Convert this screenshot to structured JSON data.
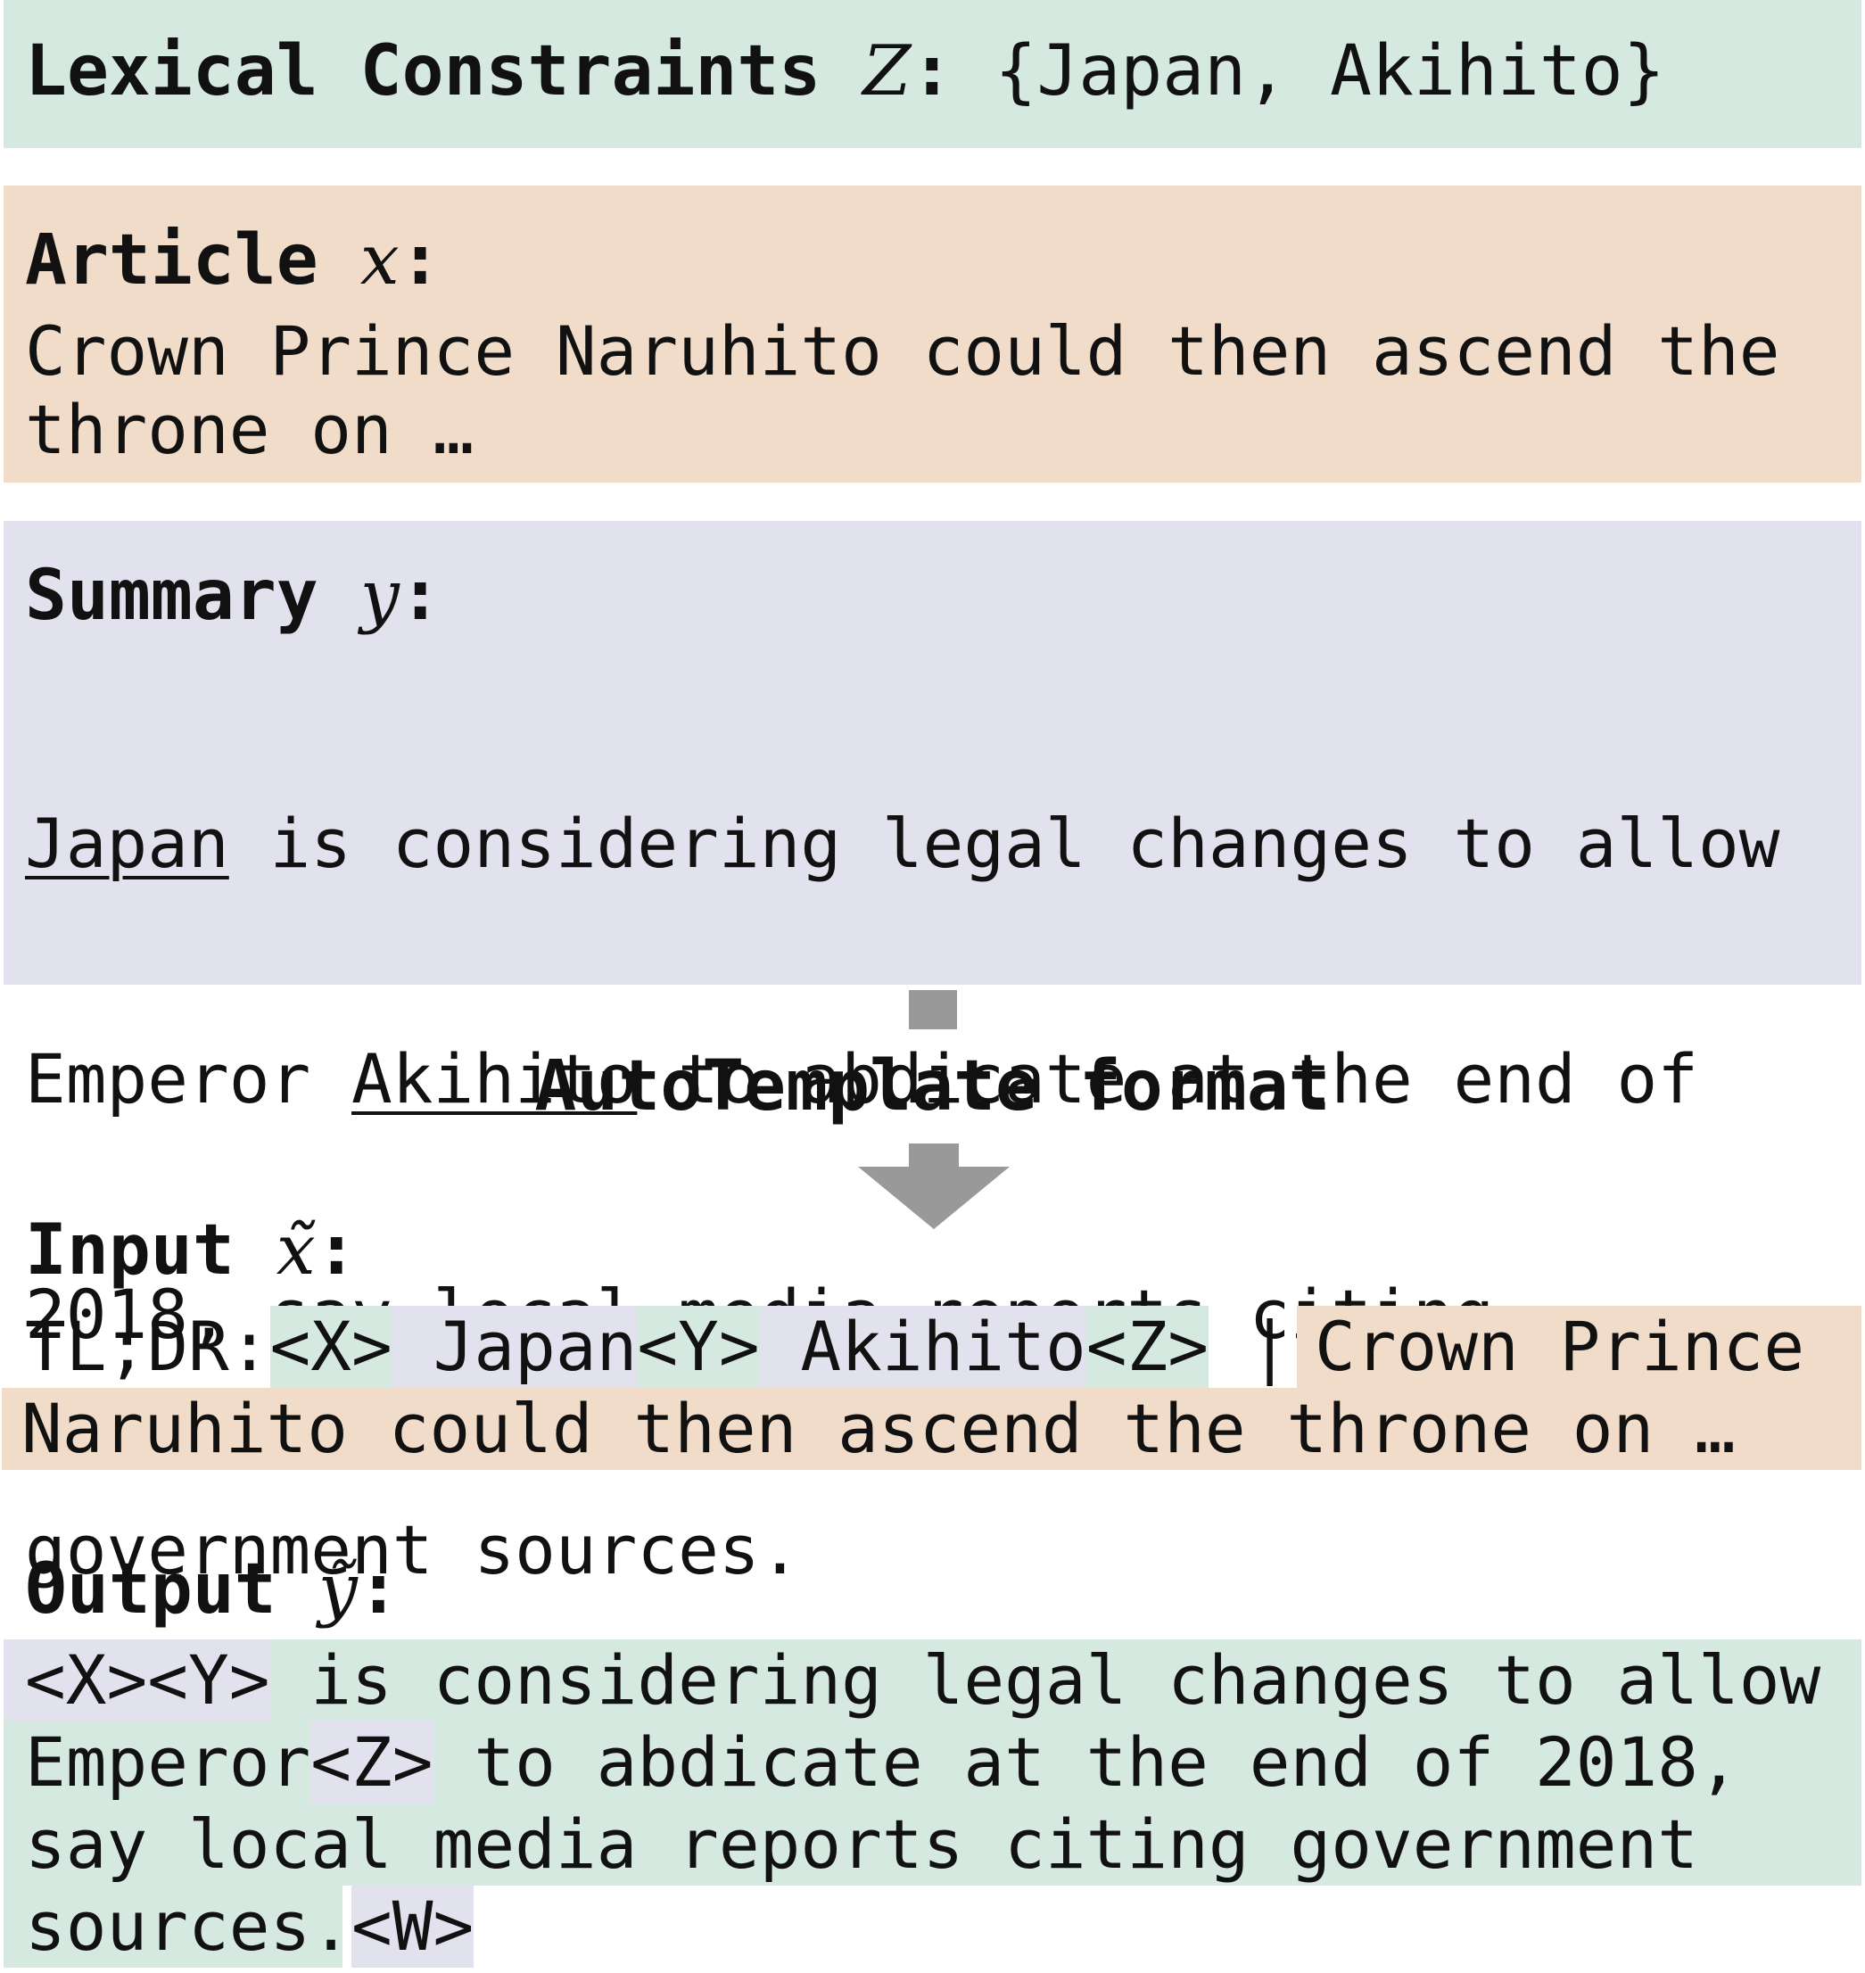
{
  "constraints": {
    "label": "Lexical Constraints",
    "symbol": "Z",
    "colon": ":",
    "value": "{Japan, Akihito}"
  },
  "article": {
    "label": "Article",
    "symbol": "x",
    "colon": ":",
    "lines": [
      "Crown Prince Naruhito could then ascend the",
      "throne on …"
    ]
  },
  "summary": {
    "label": "Summary",
    "symbol": "y",
    "colon": ":",
    "line1_u": "Japan",
    "line1_rest": " is considering legal changes to allow",
    "line2_pre": "Emperor ",
    "line2_u": "Akihito",
    "line2_rest": " to abdicate at the end of",
    "line3": "2018, say local media reports citing",
    "line4": "government sources."
  },
  "transform": {
    "label": "AutoTemplate format"
  },
  "input": {
    "label": "Input",
    "symbol": "x̃",
    "colon": ":",
    "prefix": "TL;DR:",
    "tok_x": "<X>",
    "seg_japan": " Japan",
    "tok_y": "<Y>",
    "seg_akihito": " Akihito",
    "tok_z": "<Z>",
    "sep": " | ",
    "article_part1": "Crown Prince ",
    "article_part2": "Naruhito could then ascend the throne on …"
  },
  "output": {
    "label": "Output",
    "symbol": "ỹ",
    "colon": ":",
    "tok_xy": "<X><Y>",
    "line1_rest": " is considering legal changes to allow",
    "line2_pre": "Emperor",
    "tok_z": "<Z>",
    "line2_rest": " to abdicate at the end of 2018,",
    "line3": "say local media reports citing government",
    "line4": "sources.",
    "tok_w": "<W>"
  }
}
